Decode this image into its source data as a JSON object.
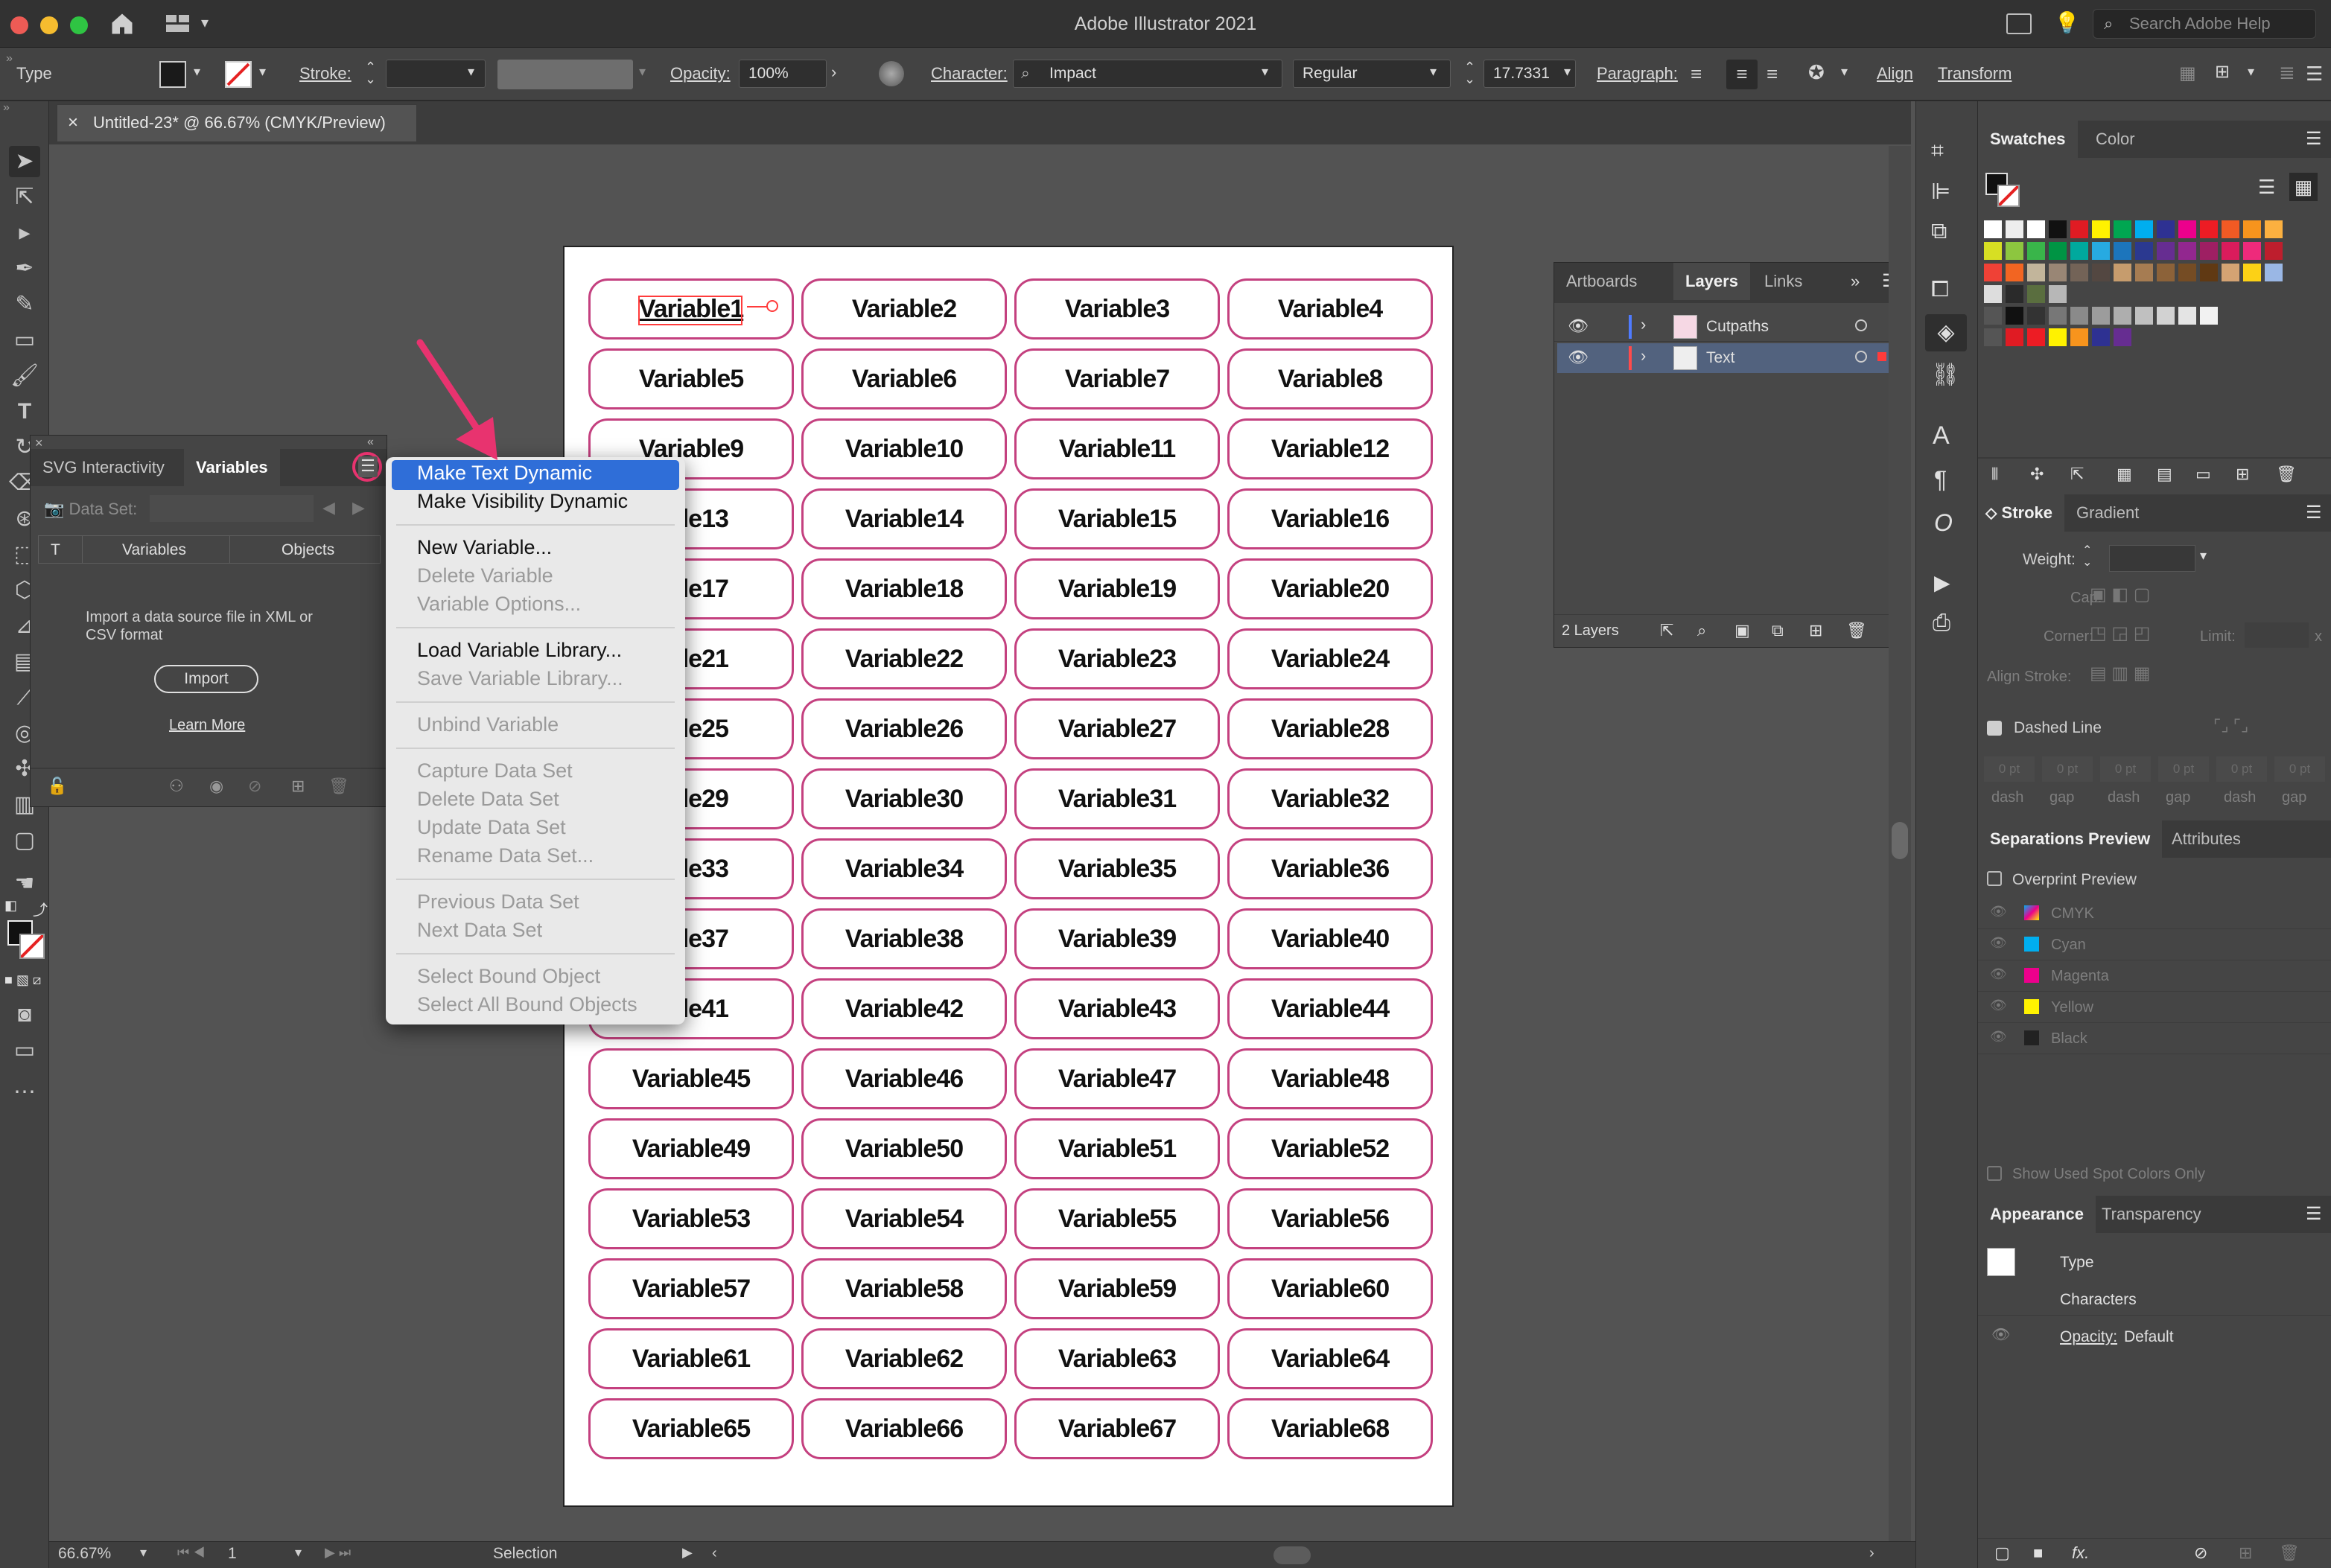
{
  "app": {
    "title": "Adobe Illustrator 2021",
    "search_placeholder": "Search Adobe Help"
  },
  "control_bar": {
    "object_type": "Type",
    "stroke_label": "Stroke:",
    "opacity_label": "Opacity:",
    "opacity_value": "100%",
    "character_label": "Character:",
    "font_family": "Impact",
    "font_style": "Regular",
    "font_size": "17.7331",
    "paragraph_label": "Paragraph:",
    "align_label": "Align",
    "transform_label": "Transform"
  },
  "document_tab": {
    "title": "Untitled-23* @ 66.67% (CMYK/Preview)"
  },
  "artboard": {
    "variables": [
      "Variable1",
      "Variable2",
      "Variable3",
      "Variable4",
      "Variable5",
      "Variable6",
      "Variable7",
      "Variable8",
      "Variable9",
      "Variable10",
      "Variable11",
      "Variable12",
      "Variable13",
      "Variable14",
      "Variable15",
      "Variable16",
      "Variable17",
      "Variable18",
      "Variable19",
      "Variable20",
      "Variable21",
      "Variable22",
      "Variable23",
      "Variable24",
      "Variable25",
      "Variable26",
      "Variable27",
      "Variable28",
      "Variable29",
      "Variable30",
      "Variable31",
      "Variable32",
      "Variable33",
      "Variable34",
      "Variable35",
      "Variable36",
      "Variable37",
      "Variable38",
      "Variable39",
      "Variable40",
      "Variable41",
      "Variable42",
      "Variable43",
      "Variable44",
      "Variable45",
      "Variable46",
      "Variable47",
      "Variable48",
      "Variable49",
      "Variable50",
      "Variable51",
      "Variable52",
      "Variable53",
      "Variable54",
      "Variable55",
      "Variable56",
      "Variable57",
      "Variable58",
      "Variable59",
      "Variable60",
      "Variable61",
      "Variable62",
      "Variable63",
      "Variable64",
      "Variable65",
      "Variable66",
      "Variable67",
      "Variable68"
    ],
    "left_column_visible": [
      "Variable1",
      "Variable5",
      "Variable9",
      "able13",
      "able17",
      "able21",
      "able25",
      "able29",
      "able33",
      "able37",
      "able41",
      "Variable45",
      "Variable49",
      "Variable53",
      "Variable57",
      "Variable61",
      "Variable65"
    ]
  },
  "variables_panel": {
    "tab_svg": "SVG Interactivity",
    "tab_variables": "Variables",
    "data_set_label": "Data Set:",
    "col_type": "T",
    "col_variables": "Variables",
    "col_objects": "Objects",
    "message": "Import a data source file in XML or CSV format",
    "import_button": "Import",
    "learn_more": "Learn More"
  },
  "flyout_menu": {
    "make_text_dynamic": "Make Text Dynamic",
    "make_visibility_dynamic": "Make Visibility Dynamic",
    "new_variable": "New Variable...",
    "delete_variable": "Delete Variable",
    "variable_options": "Variable Options...",
    "load_variable_library": "Load Variable Library...",
    "save_variable_library": "Save Variable Library...",
    "unbind_variable": "Unbind Variable",
    "capture_data_set": "Capture Data Set",
    "delete_data_set": "Delete Data Set",
    "update_data_set": "Update Data Set",
    "rename_data_set": "Rename Data Set...",
    "previous_data_set": "Previous Data Set",
    "next_data_set": "Next Data Set",
    "select_bound_object": "Select Bound Object",
    "select_all_bound_objects": "Select All Bound Objects"
  },
  "layers_panel": {
    "tab_artboards": "Artboards",
    "tab_layers": "Layers",
    "tab_links": "Links",
    "layer_cutpaths": "Cutpaths",
    "layer_text": "Text",
    "layer_count": "2 Layers"
  },
  "swatches_panel": {
    "tab_swatches": "Swatches",
    "tab_color": "Color"
  },
  "stroke_panel": {
    "tab_stroke": "Stroke",
    "tab_gradient": "Gradient",
    "weight_label": "Weight:",
    "cap_label": "Cap:",
    "corner_label": "Corner:",
    "limit_label": "Limit:",
    "align_stroke_label": "Align Stroke:",
    "dashed_line_label": "Dashed Line",
    "dash_placeholder": "0 pt",
    "dash_label": "dash",
    "gap_label": "gap"
  },
  "separations_panel": {
    "tab_separations": "Separations Preview",
    "tab_attributes": "Attributes",
    "overprint_preview": "Overprint Preview",
    "inks": [
      "CMYK",
      "Cyan",
      "Magenta",
      "Yellow",
      "Black"
    ],
    "show_used_spot": "Show Used Spot Colors Only"
  },
  "appearance_panel": {
    "tab_appearance": "Appearance",
    "tab_transparency": "Transparency",
    "type_label": "Type",
    "characters_label": "Characters",
    "opacity_label": "Opacity:",
    "opacity_value": "Default"
  },
  "status_bar": {
    "zoom": "66.67%",
    "artboard_number": "1",
    "tool_name": "Selection"
  },
  "colors": {
    "accent_highlight": "#2f6ed8",
    "cell_border": "#c4407f",
    "annotation_pink": "#e8336f"
  }
}
